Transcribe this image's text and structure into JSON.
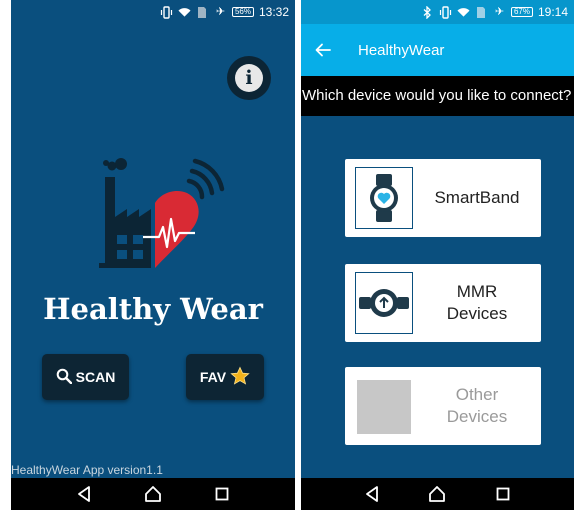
{
  "screen1": {
    "status": {
      "battery": "56%",
      "time": "13:32"
    },
    "info_label": "i",
    "title": "Healthy Wear",
    "scan_label": "SCAN",
    "fav_label": "FAV",
    "version": "HealthyWear App version1.1"
  },
  "screen2": {
    "status": {
      "battery": "67%",
      "time": "19:14"
    },
    "appbar_title": "HealthyWear",
    "prompt": "Which device would you like to connect?",
    "devices": [
      {
        "label": "SmartBand",
        "icon": "smartwatch-heart-icon",
        "enabled": true
      },
      {
        "label": "MMR\nDevices",
        "icon": "mmr-sensor-icon",
        "enabled": true
      },
      {
        "label": "Other\nDevices",
        "icon": "placeholder-image",
        "enabled": false
      }
    ]
  },
  "colors": {
    "background": "#0a4f7e",
    "appbar": "#07aee8",
    "button_dark": "#0d2534",
    "heart_red": "#d92a34",
    "star": "#f2b21b"
  }
}
